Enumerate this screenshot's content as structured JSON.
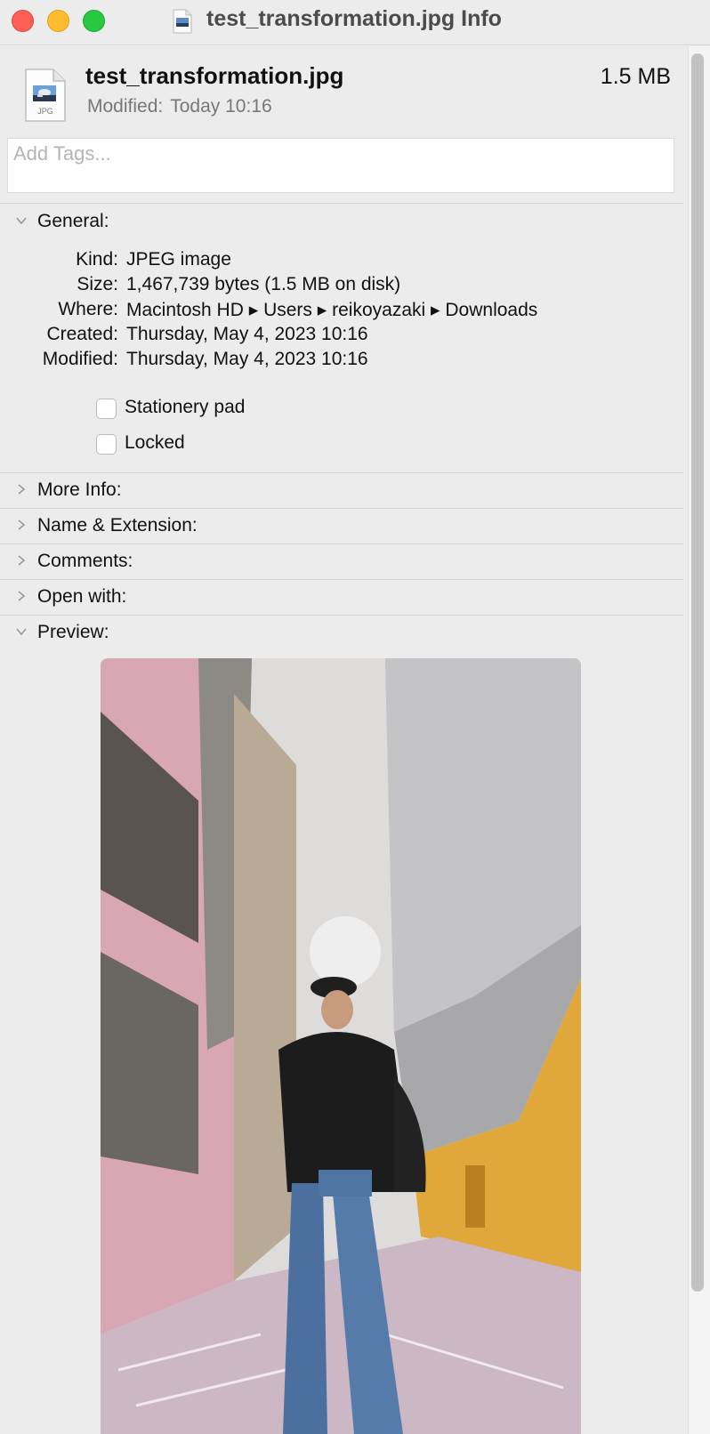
{
  "window": {
    "title": "test_transformation.jpg Info"
  },
  "header": {
    "file_name": "test_transformation.jpg",
    "file_size": "1.5 MB",
    "modified_label": "Modified:",
    "modified_value": "Today 10:16",
    "icon_badge": "JPG"
  },
  "tags": {
    "placeholder": "Add Tags...",
    "value": ""
  },
  "general": {
    "label": "General:",
    "expanded": true,
    "rows": [
      {
        "key": "Kind:",
        "value": "JPEG image"
      },
      {
        "key": "Size:",
        "value": "1,467,739 bytes (1.5 MB on disk)"
      },
      {
        "key": "Where:",
        "value": "Macintosh HD ▸ Users ▸ reikoyazaki ▸ Downloads"
      },
      {
        "key": "Created:",
        "value": "Thursday, May 4, 2023 10:16"
      },
      {
        "key": "Modified:",
        "value": "Thursday, May 4, 2023 10:16"
      }
    ],
    "checkboxes": [
      {
        "label": "Stationery pad",
        "checked": false
      },
      {
        "label": "Locked",
        "checked": false
      }
    ]
  },
  "sections": [
    {
      "label": "More Info:",
      "expanded": false
    },
    {
      "label": "Name & Extension:",
      "expanded": false
    },
    {
      "label": "Comments:",
      "expanded": false
    },
    {
      "label": "Open with:",
      "expanded": false
    },
    {
      "label": "Preview:",
      "expanded": true
    }
  ],
  "colors": {
    "close": "#fe5f57",
    "minimize": "#febc2e",
    "zoom": "#28c840",
    "window_bg": "#ececec"
  }
}
